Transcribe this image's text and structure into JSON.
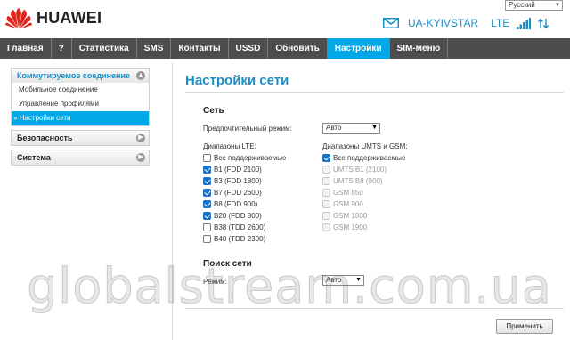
{
  "brand": {
    "name": "HUAWEI",
    "color": "#e2231a"
  },
  "language": {
    "selected": "Русский"
  },
  "status": {
    "operator": "UA-KYIVSTAR",
    "network_type": "LTE",
    "icons": [
      "mail-icon",
      "signal-icon",
      "data-transfer-icon"
    ]
  },
  "nav": {
    "items": [
      {
        "label": "Главная",
        "active": false
      },
      {
        "label": "?",
        "active": false
      },
      {
        "label": "Статистика",
        "active": false
      },
      {
        "label": "SMS",
        "active": false
      },
      {
        "label": "Контакты",
        "active": false
      },
      {
        "label": "USSD",
        "active": false
      },
      {
        "label": "Обновить",
        "active": false
      },
      {
        "label": "Настройки",
        "active": true
      },
      {
        "label": "SIM-меню",
        "active": false
      }
    ]
  },
  "sidebar": {
    "groups": [
      {
        "label": "Коммутируемое соединение",
        "items": [
          "Мобильное соединение",
          "Управление профилями",
          "Настройки сети"
        ]
      },
      {
        "label": "Безопасность"
      },
      {
        "label": "Система"
      }
    ],
    "active_marker": "»"
  },
  "main": {
    "title": "Настройки сети",
    "network": {
      "title": "Сеть",
      "preferred_mode_label": "Предпочтительный режим:",
      "preferred_mode_value": "Авто",
      "lte_bands_title": "Диапазоны LTE:",
      "lte_bands": [
        {
          "label": "Все поддерживаемые",
          "checked": false
        },
        {
          "label": "B1 (FDD 2100)",
          "checked": true
        },
        {
          "label": "B3 (FDD 1800)",
          "checked": true
        },
        {
          "label": "B7 (FDD 2600)",
          "checked": true
        },
        {
          "label": "B8 (FDD 900)",
          "checked": true
        },
        {
          "label": "B20 (FDD 800)",
          "checked": true
        },
        {
          "label": "B38 (TDD 2600)",
          "checked": false
        },
        {
          "label": "B40 (TDD 2300)",
          "checked": false
        }
      ],
      "umts_gsm_title": "Диапазоны UMTS и GSM:",
      "umts_gsm_bands": [
        {
          "label": "Все поддерживаемые",
          "checked": true,
          "disabled": false
        },
        {
          "label": "UMTS B1 (2100)",
          "checked": false,
          "disabled": true
        },
        {
          "label": "UMTS B8 (900)",
          "checked": false,
          "disabled": true
        },
        {
          "label": "GSM 850",
          "checked": false,
          "disabled": true
        },
        {
          "label": "GSM 900",
          "checked": false,
          "disabled": true
        },
        {
          "label": "GSM 1800",
          "checked": false,
          "disabled": true
        },
        {
          "label": "GSM 1900",
          "checked": false,
          "disabled": true
        }
      ]
    },
    "search": {
      "title": "Поиск сети",
      "mode_label": "Режим:",
      "mode_value": "Авто"
    },
    "apply_label": "Применить"
  },
  "watermark": "globalstream.com.ua",
  "colors": {
    "accent": "#00a8e8",
    "nav_bg": "#4d4d4d",
    "title": "#1a8fc7"
  }
}
